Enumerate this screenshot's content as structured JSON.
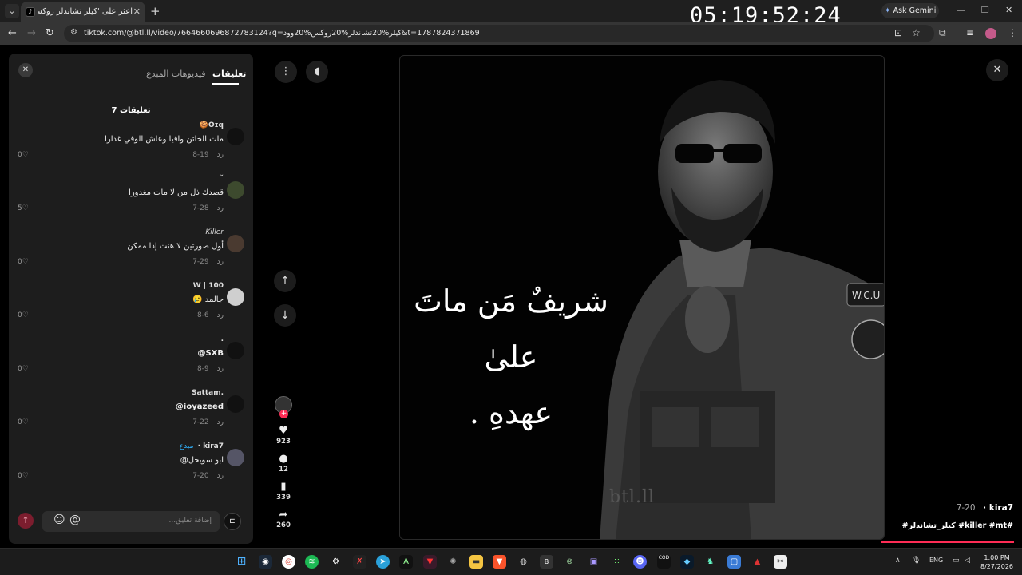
{
  "browser": {
    "tab_title": "اعثر على 'كيلر تشاندلر روكس وود",
    "clock": "05:19:52:24",
    "gemini_label": "Ask Gemini",
    "url": "tiktok.com/@btl.ll/video/7664660696872783124?q=كيلر%20تشاندلر%20روكس%20وود&t=1787824371869"
  },
  "panel": {
    "tab_comments": "تعليقات",
    "tab_creator_videos": "فيديوهات المبدع",
    "comment_count": "7 تعليقات",
    "comments": [
      {
        "user": "🍪Oɪq",
        "text": "مات الخائن وافيا وعاش الوفي غدارا",
        "date": "8-19",
        "reply": "رد",
        "likes": "0"
      },
      {
        "user": "ˇ",
        "text": "قصدك ذل من لا مات مغدورا",
        "date": "7-28",
        "reply": "رد",
        "likes": "5"
      },
      {
        "user": "Killer",
        "text": "أول صورتين لا هنت إذا ممكن",
        "date": "7-29",
        "reply": "رد",
        "likes": "0"
      },
      {
        "user": "W | 100",
        "text": "جالمد 🥲",
        "date": "8-6",
        "reply": "رد",
        "likes": "0"
      },
      {
        "user": ".",
        "text": "@SXB",
        "date": "8-9",
        "reply": "رد",
        "likes": "0"
      },
      {
        "user": "Sattam.",
        "text": "@ioyazeed",
        "date": "7-22",
        "reply": "رد",
        "likes": "0"
      },
      {
        "user": "kira7",
        "creator_badge": "مبدع",
        "text": "ابو سويحل@",
        "date": "7-20",
        "reply": "رد",
        "likes": "0"
      }
    ],
    "composer_placeholder": "إضافة تعليق..."
  },
  "video": {
    "caption_line1": "شريفٌ مَن ماتَ علىٰ",
    "caption_line2": "عهدهِ .",
    "watermark": "btl.ll",
    "likes": "923",
    "comments": "12",
    "saves": "339",
    "shares": "260",
    "author": "kira7",
    "author_date": "7-20",
    "tags": "#كيلر_تشاندلر #killer #mt#",
    "progress_fraction": 0.25
  },
  "taskbar": {
    "lang": "ENG",
    "time": "1:00 PM",
    "date": "8/27/2026"
  }
}
